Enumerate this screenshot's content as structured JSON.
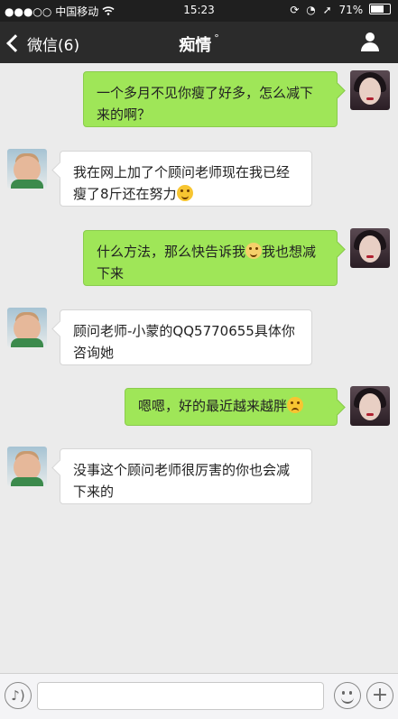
{
  "status_bar": {
    "signal": "●●●○○",
    "carrier": "中国移动",
    "wifi_icon": "wifi-icon",
    "time": "15:23",
    "battery_percent": "71%",
    "battery_level": 0.71
  },
  "nav": {
    "back_label": "微信(6)",
    "title": "痴情",
    "title_suffix": "°",
    "profile_icon": "person-icon"
  },
  "messages": [
    {
      "side": "me",
      "text_before": "一个多月不见你瘦了好多，怎么减下来的啊？",
      "text_after": ""
    },
    {
      "side": "friend",
      "text_before": "我在网上加了个顾问老师现在我已经瘦了8斤还在努力",
      "text_after": "",
      "emoji": "grin-emoji"
    },
    {
      "side": "me",
      "text_before": "什么方法，那么快告诉我",
      "emoji": "shy-emoji",
      "text_after": "我也想减下来"
    },
    {
      "side": "friend",
      "text_before": "顾问老师-小蒙的QQ5770655具体你咨询她",
      "text_after": ""
    },
    {
      "side": "me",
      "text_before": "嗯嗯，好的最近越来越胖",
      "text_after": "",
      "emoji": "frown-emoji"
    },
    {
      "side": "friend",
      "text_before": "没事这个顾问老师很厉害的你也会减下来的",
      "text_after": ""
    }
  ],
  "input_bar": {
    "voice_icon": "voice-icon",
    "voice_glyph": "♪)",
    "placeholder": "",
    "emoji_icon": "smile-icon",
    "plus_icon": "plus-icon",
    "plus_glyph": "+"
  }
}
